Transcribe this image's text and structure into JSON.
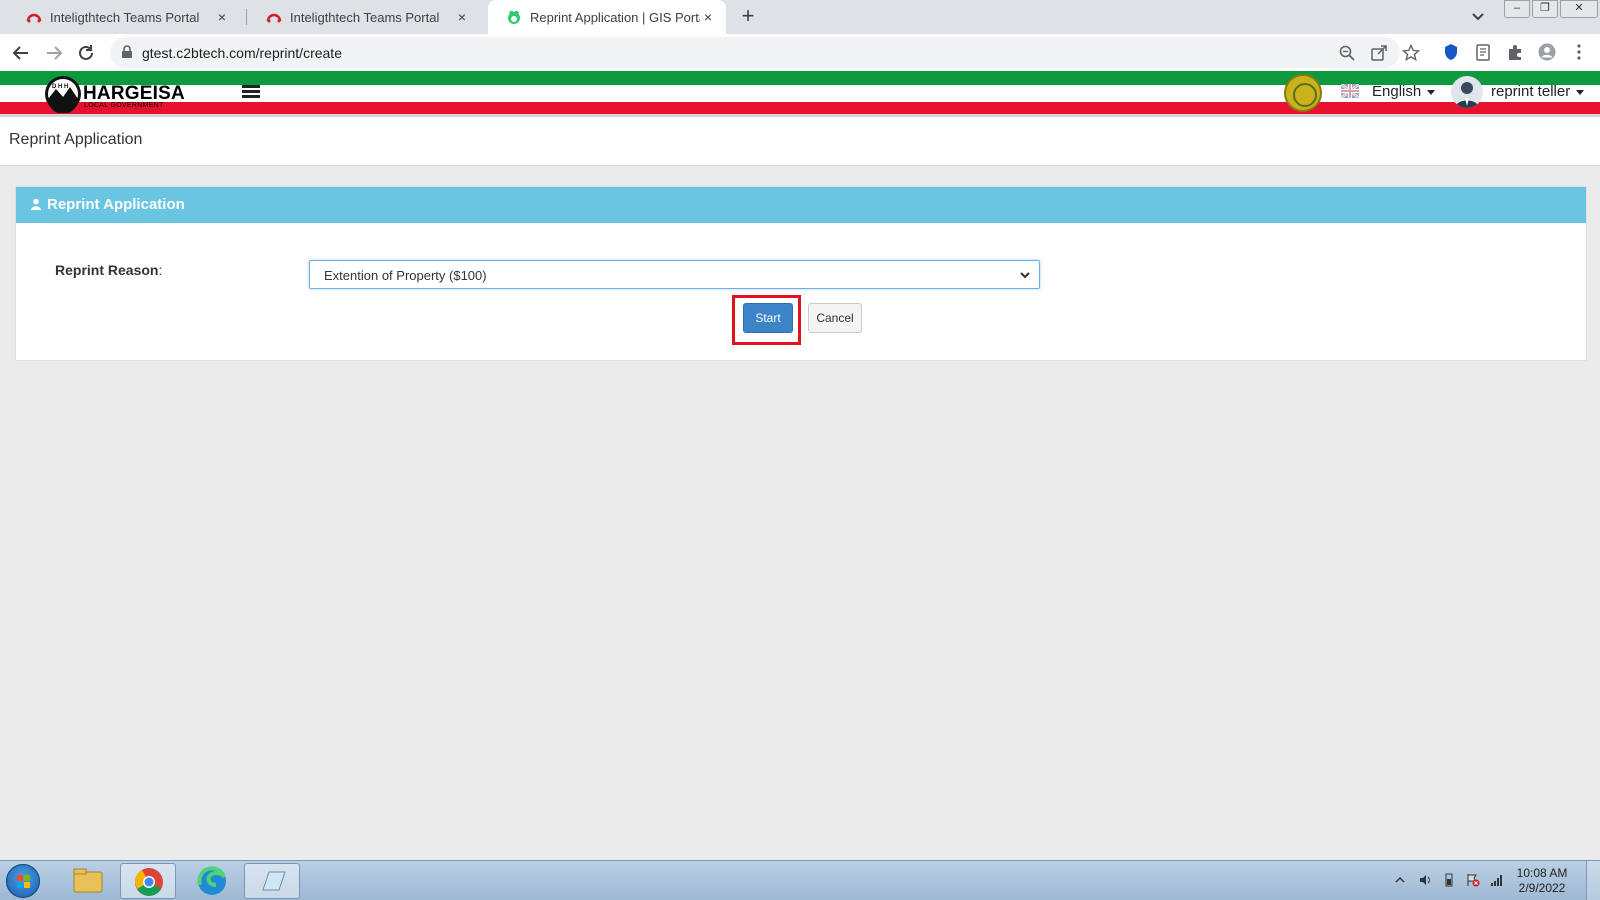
{
  "browser": {
    "tabs": [
      {
        "title": "Inteligthtech Teams Portal",
        "active": false
      },
      {
        "title": "Inteligthtech Teams Portal",
        "active": false
      },
      {
        "title": "Reprint Application | GIS Portal",
        "active": true
      }
    ],
    "new_tab_label": "+",
    "close_glyph": "×",
    "url": "gtest.c2btech.com/reprint/create"
  },
  "header": {
    "logo_text": "HARGEISA",
    "logo_subtext": "LOCAL GOVERNMENT",
    "language": "English",
    "user": "reprint teller"
  },
  "page": {
    "title": "Reprint Application"
  },
  "panel": {
    "heading": "Reprint Application",
    "field_label": "Reprint Reason",
    "field_colon": ":",
    "select_value": "Extention of Property ($100)",
    "start_label": "Start",
    "cancel_label": "Cancel"
  },
  "taskbar": {
    "time": "10:08 AM",
    "date": "2/9/2022"
  },
  "colors": {
    "panel_heading": "#69c5e2",
    "start_button": "#3c83c7",
    "highlight": "#e0141e",
    "flag_green": "#0d9a3f",
    "flag_red": "#e8112d"
  }
}
